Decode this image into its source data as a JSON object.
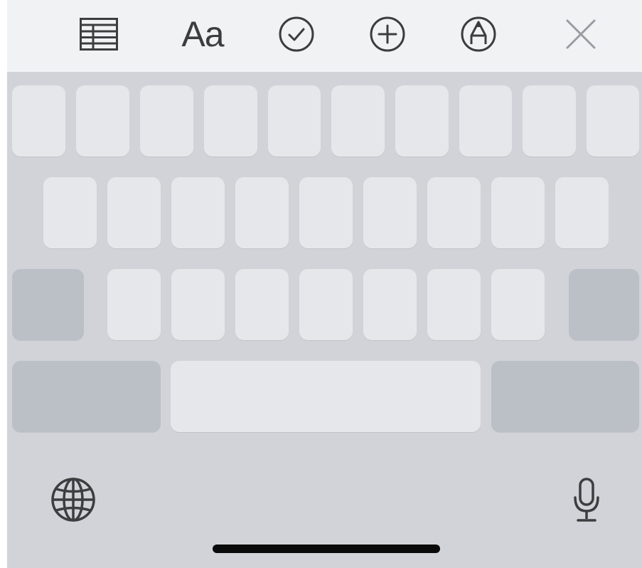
{
  "toolbar": {
    "items": [
      {
        "name": "table-icon"
      },
      {
        "name": "text-format-icon",
        "label": "Aa"
      },
      {
        "name": "checklist-icon"
      },
      {
        "name": "insert-plus-icon"
      },
      {
        "name": "markup-pen-icon"
      },
      {
        "name": "close-icon"
      }
    ]
  },
  "keyboard": {
    "rows": [
      {
        "letter_keys": 10
      },
      {
        "letter_keys": 9
      },
      {
        "letter_keys": 7,
        "left_function_key": "shift-key",
        "right_function_key": "delete-key"
      },
      {
        "left_function_key": "numbers-key",
        "center_key": "space-bar",
        "right_function_key": "return-key"
      }
    ],
    "bottom": {
      "left_icon": "globe-icon",
      "right_icon": "microphone-icon"
    }
  },
  "colors": {
    "keyboard_background": "#d1d3d9",
    "toolbar_background": "#f1f2f4",
    "letter_key": "#e6e7ea",
    "function_key": "#bbbfc6",
    "icon": "#3d3d40",
    "home_indicator": "#0a0a0a"
  }
}
